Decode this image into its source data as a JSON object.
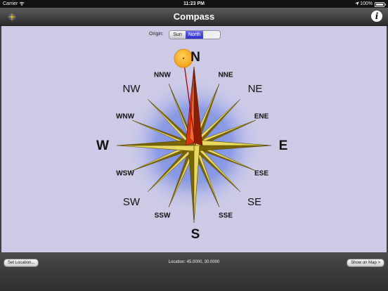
{
  "status_bar": {
    "carrier": "Carrier",
    "time": "11:23 PM",
    "battery": "100%"
  },
  "nav": {
    "title": "Compass",
    "info_label": "i"
  },
  "origin": {
    "label": "Origin:",
    "options": [
      "Sun",
      "North"
    ],
    "selected": "North"
  },
  "compass": {
    "cardinals": {
      "N": "N",
      "E": "E",
      "S": "S",
      "W": "W"
    },
    "intercardinals": {
      "NE": "NE",
      "SE": "SE",
      "SW": "SW",
      "NW": "NW"
    },
    "secondary": {
      "NNE": "NNE",
      "ENE": "ENE",
      "ESE": "ESE",
      "SSE": "SSE",
      "SSW": "SSW",
      "WSW": "WSW",
      "WNW": "WNW",
      "NNW": "NNW"
    },
    "colors": {
      "background": "#cccae6",
      "glow": "#6f86e8",
      "star_light": "#e8d860",
      "star_dark": "#7a6400",
      "needle": "#e03010",
      "sun": "#f7b52a"
    }
  },
  "toolbar": {
    "set_location_label": "Set Location...",
    "location_text": "Location:  45.0000,  30.0000",
    "show_on_map_label": "Show on Map >"
  }
}
